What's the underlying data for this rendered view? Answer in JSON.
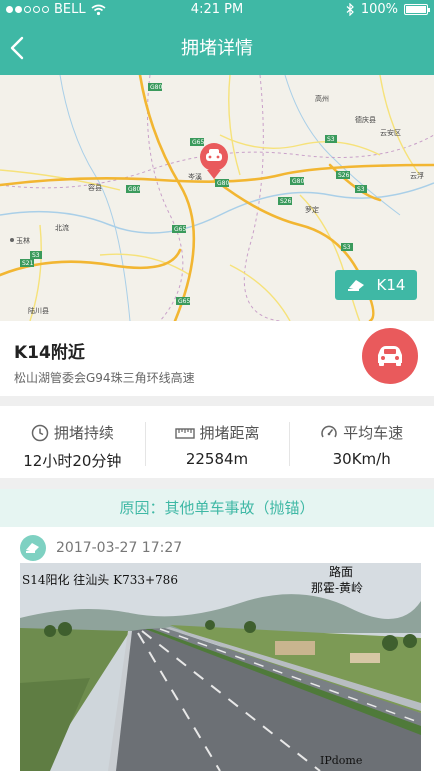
{
  "status_bar": {
    "carrier": "BELL",
    "time": "4:21 PM",
    "battery": "100%"
  },
  "nav": {
    "title": "拥堵详情"
  },
  "map": {
    "road_labels": [
      "G80",
      "G65",
      "G65",
      "G80",
      "G80",
      "G80",
      "G65",
      "S26",
      "S26",
      "S3",
      "S3",
      "S3",
      "S3",
      "S21"
    ],
    "place_labels": [
      "玉林",
      "北流",
      "容县",
      "岑溪",
      "云浮",
      "云安区",
      "罗定",
      "陆川县",
      "高州",
      "德庆县"
    ],
    "badge_label": "K14"
  },
  "location": {
    "name": "K14附近",
    "sub": "松山湖管委会G94珠三角环线高速"
  },
  "stats": [
    {
      "label": "拥堵持续",
      "value": "12小时20分钟"
    },
    {
      "label": "拥堵距离",
      "value": "22584m"
    },
    {
      "label": "平均车速",
      "value": "30Km/h"
    }
  ],
  "reason": "原因：其他单车事故（抛锚）",
  "report": {
    "timestamp": "2017-03-27 17:27",
    "overlay_top_left": "S14阳化 往汕头 K733+786",
    "overlay_top_right_1": "路面",
    "overlay_top_right_2": "那霍-黄岭",
    "overlay_bottom": "IPdome"
  },
  "colors": {
    "accent": "#3fb8a5",
    "danger": "#e95a5c"
  }
}
